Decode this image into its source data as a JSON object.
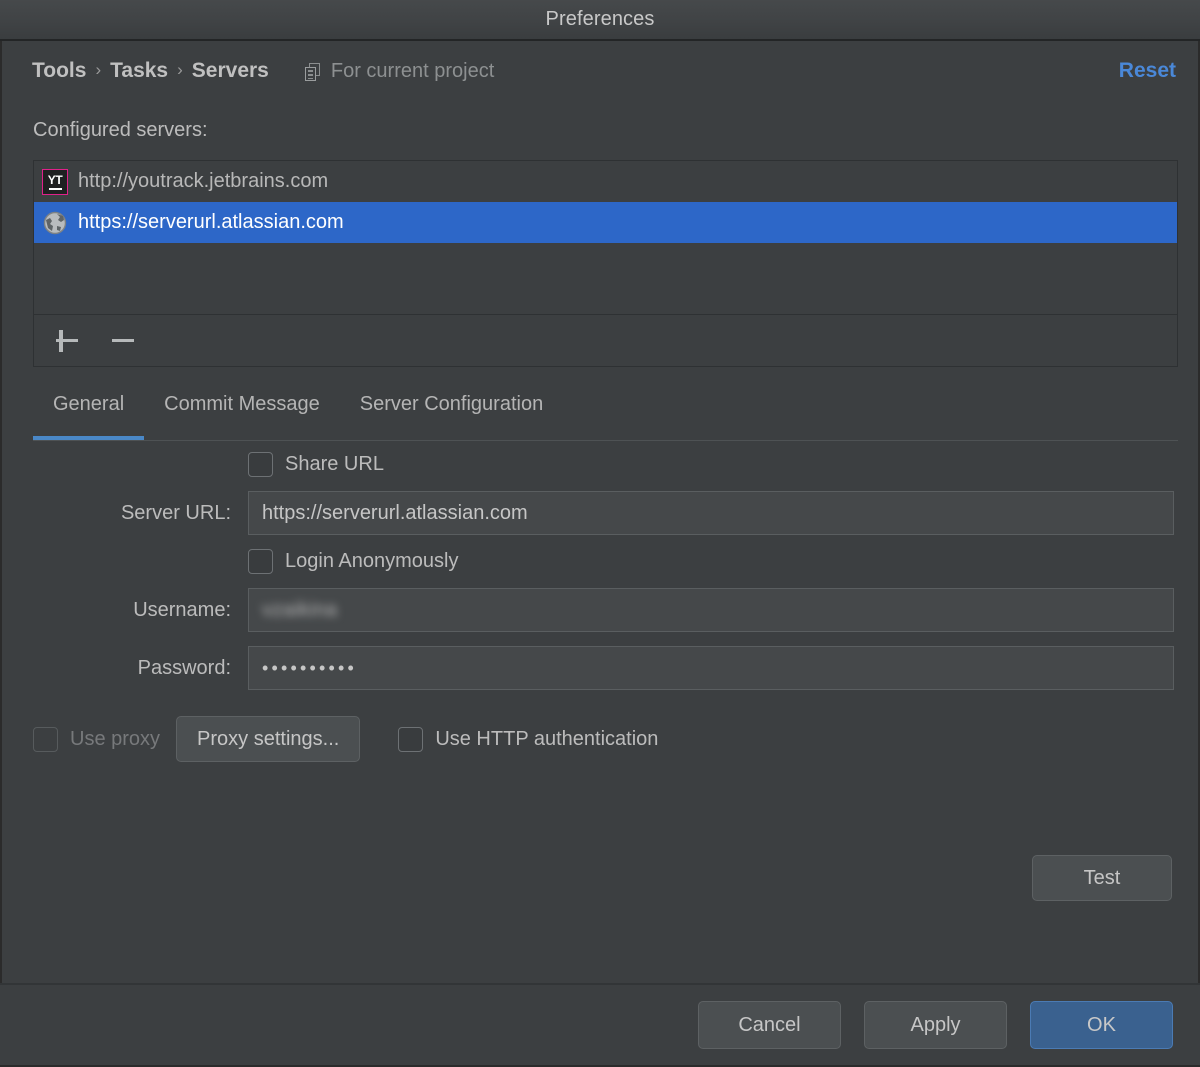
{
  "window": {
    "title": "Preferences"
  },
  "header": {
    "breadcrumb": [
      "Tools",
      "Tasks",
      "Servers"
    ],
    "separator": "›",
    "scope_note": "For current project",
    "scope_icon": "copy-icon",
    "reset_label": "Reset",
    "reset_color": "#4a88d8"
  },
  "servers_section": {
    "label": "Configured servers:",
    "items": [
      {
        "icon": "youtrack-icon",
        "icon_text": "YT",
        "url": "http://youtrack.jetbrains.com",
        "selected": false
      },
      {
        "icon": "globe-icon",
        "url": "https://serverurl.atlassian.com",
        "selected": true
      }
    ],
    "selection_color": "#2d67c8",
    "toolbar": {
      "add_label": "+",
      "remove_label": "−"
    }
  },
  "tabs": {
    "items": [
      {
        "label": "General",
        "active": true
      },
      {
        "label": "Commit Message",
        "active": false
      },
      {
        "label": "Server Configuration",
        "active": false
      }
    ],
    "active_underline_color": "#4a88c7"
  },
  "general_tab": {
    "share_url": {
      "label": "Share URL",
      "checked": false
    },
    "server_url": {
      "label": "Server URL:",
      "value": "https://serverurl.atlassian.com"
    },
    "login_anonymously": {
      "label": "Login Anonymously",
      "checked": false
    },
    "username": {
      "label": "Username:",
      "value": "vzaikina",
      "redacted": true
    },
    "password": {
      "label": "Password:",
      "value": "••••••••••"
    },
    "use_proxy": {
      "label": "Use proxy",
      "checked": false,
      "disabled": true
    },
    "proxy_settings_button": "Proxy settings...",
    "use_http_auth": {
      "label": "Use HTTP authentication",
      "checked": false
    },
    "test_button": "Test"
  },
  "footer": {
    "cancel_label": "Cancel",
    "apply_label": "Apply",
    "ok_label": "OK",
    "ok_color": "#3a618f"
  }
}
